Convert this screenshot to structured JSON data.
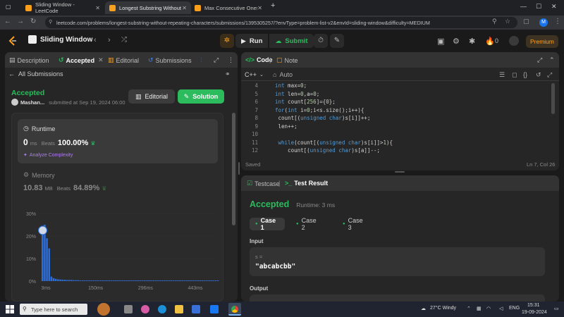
{
  "browser": {
    "tabs": [
      {
        "title": "Sliding Window - LeetCode",
        "active": false
      },
      {
        "title": "Longest Substring Without Repe",
        "active": true
      },
      {
        "title": "Max Consecutive Ones II - Leet",
        "active": false
      }
    ],
    "url": "leetcode.com/problems/longest-substring-without-repeating-characters/submissions/1395305257/?envType=problem-list-v2&envId=sliding-window&difficulty=MEDIUM",
    "profile_initial": "M",
    "window_controls": [
      "—",
      "☐",
      "✕"
    ]
  },
  "navbar": {
    "problem_list": "Sliding Window",
    "run_label": "Run",
    "submit_label": "Submit",
    "streak_count": "0",
    "premium_label": "Premium"
  },
  "left_panel": {
    "tabs": [
      "Description",
      "Accepted",
      "Editorial",
      "Submissions"
    ],
    "back_label": "All Submissions",
    "status": "Accepted",
    "user": "Mashan...",
    "submitted_at": "submitted at Sep 19, 2024 06:00",
    "editorial_btn": "Editorial",
    "solution_btn": "Solution",
    "runtime": {
      "title": "Runtime",
      "value": "0",
      "unit": "ms",
      "beats_label": "Beats",
      "beats": "100.00%",
      "analyze": "Analyze Complexity"
    },
    "memory": {
      "title": "Memory",
      "value": "10.83",
      "unit": "MB",
      "beats_label": "Beats",
      "beats": "84.89%"
    }
  },
  "chart_data": {
    "type": "bar",
    "ylim": [
      0,
      30
    ],
    "yticks": [
      "30%",
      "20%",
      "10%",
      "0%"
    ],
    "xticks": [
      "3ms",
      "150ms",
      "296ms",
      "443ms"
    ],
    "values": [
      22.5,
      25,
      19,
      14.5,
      2,
      1.3,
      1,
      0.8,
      0.7,
      0.6,
      0.6,
      0.5,
      0.5,
      0.5,
      0.4,
      0.4,
      0.4,
      0.3,
      0.3,
      0.3,
      0.3,
      0.3,
      0.3,
      0.3,
      0.3,
      0.3,
      0.3,
      0.3,
      0.3,
      0.3,
      0.3,
      0.3,
      0.3,
      0.3,
      0.3,
      0.3,
      0.3,
      0.3,
      0.3,
      0.3,
      0.3,
      0.3,
      0.3,
      0.3,
      0.3,
      0.3,
      0.3,
      0.3,
      0.3,
      0.3,
      0.3,
      0.3,
      0.3,
      0.3,
      0.3,
      0.3,
      0.3,
      0.3,
      0.3,
      0.3,
      0.3,
      0.3,
      0.3,
      0.3,
      0.3,
      0.3,
      0.3,
      0.3,
      0.3,
      0.3,
      0.3,
      0.3,
      0.3,
      0.3,
      0.3,
      0.3,
      0.3,
      0.3,
      0.3,
      0.3
    ],
    "highlight_index": 0,
    "color": "#2e6cd6"
  },
  "code_panel": {
    "tabs": [
      "Code",
      "Note"
    ],
    "language": "C++",
    "auto_label": "Auto",
    "saved_label": "Saved",
    "cursor_label": "Ln 7, Col 26",
    "lines": [
      {
        "no": "4",
        "text": "int max=0;"
      },
      {
        "no": "5",
        "text": "int len=0,a=0;"
      },
      {
        "no": "6",
        "text": "int count[256]={0};"
      },
      {
        "no": "7",
        "text": "for(int i=0;i<s.size();i++){"
      },
      {
        "no": "8",
        "text": " count[(unsigned char)s[i]]++;"
      },
      {
        "no": "9",
        "text": " len++;"
      },
      {
        "no": "10",
        "text": ""
      },
      {
        "no": "11",
        "text": " while(count[(unsigned char)s[i]]>1){"
      },
      {
        "no": "12",
        "text": "    count[(unsigned char)s[a]]--;"
      }
    ]
  },
  "test_panel": {
    "tabs": [
      "Testcase",
      "Test Result"
    ],
    "status": "Accepted",
    "runtime": "Runtime: 3 ms",
    "cases": [
      "Case 1",
      "Case 2",
      "Case 3"
    ],
    "input_label": "Input",
    "var_label": "s =",
    "input_value": "\"abcabcbb\"",
    "output_label": "Output"
  },
  "taskbar": {
    "search_placeholder": "Type here to search",
    "weather": "27°C  Windy",
    "lang": "ENG",
    "time": "15:31",
    "date": "19-09-2024"
  }
}
